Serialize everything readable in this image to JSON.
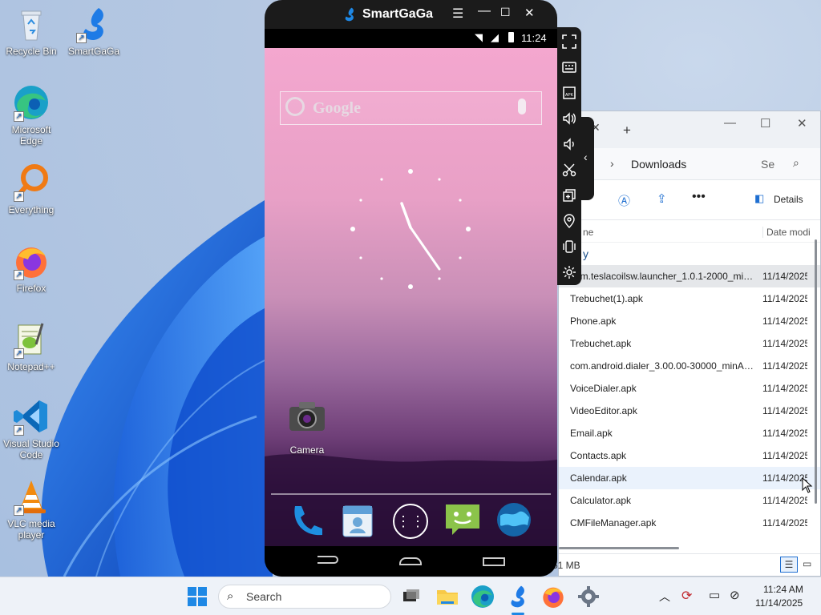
{
  "desktop": {
    "icons": [
      {
        "label": "Recycle Bin",
        "icon": "recycle-bin-icon"
      },
      {
        "label": "SmartGaGa",
        "icon": "smartgaga-icon"
      },
      {
        "label": "Microsoft Edge",
        "icon": "edge-icon"
      },
      {
        "label": "Everything",
        "icon": "everything-search-icon"
      },
      {
        "label": "Firefox",
        "icon": "firefox-icon"
      },
      {
        "label": "Notepad++",
        "icon": "notepadpp-icon"
      },
      {
        "label": "Visual Studio Code",
        "icon": "vscode-icon"
      },
      {
        "label": "VLC media player",
        "icon": "vlc-icon"
      }
    ]
  },
  "emulator": {
    "title": "SmartGaGa",
    "status_time": "11:24",
    "search_placeholder": "Google",
    "camera_label": "Camera",
    "sidebar_tools": [
      "fullscreen-icon",
      "keyboard-icon",
      "install-apk-icon",
      "volume-up-icon",
      "volume-down-icon",
      "screenshot-scissors-icon",
      "multi-instance-icon",
      "location-icon",
      "shake-icon",
      "settings-icon"
    ],
    "dock": [
      "phone-icon",
      "contacts-icon",
      "app-drawer-icon",
      "messaging-icon",
      "browser-icon"
    ],
    "accent": "#1e88e5"
  },
  "explorer": {
    "address": "Downloads",
    "search_placeholder": "Se",
    "details_label": "Details",
    "columns": {
      "name": "ne",
      "date": "Date modi"
    },
    "group_label": "y",
    "rows": [
      {
        "name": "com.teslacoilsw.launcher_1.0.1-2000_min...",
        "date": "11/14/2025"
      },
      {
        "name": "Trebuchet(1).apk",
        "date": "11/14/2025"
      },
      {
        "name": "Phone.apk",
        "date": "11/14/2025"
      },
      {
        "name": "Trebuchet.apk",
        "date": "11/14/2025"
      },
      {
        "name": "com.android.dialer_3.00.00-30000_minAP...",
        "date": "11/14/2025"
      },
      {
        "name": "VoiceDialer.apk",
        "date": "11/14/2025"
      },
      {
        "name": "VideoEditor.apk",
        "date": "11/14/2025"
      },
      {
        "name": "Email.apk",
        "date": "11/14/2025"
      },
      {
        "name": "Contacts.apk",
        "date": "11/14/2025"
      },
      {
        "name": "Calendar.apk",
        "date": "11/14/2025"
      },
      {
        "name": "Calculator.apk",
        "date": "11/14/2025"
      },
      {
        "name": "CMFileManager.apk",
        "date": "11/14/2025"
      }
    ],
    "status": "51 MB"
  },
  "taskbar": {
    "search_label": "Search",
    "time": "11:24 AM",
    "date": "11/14/2025"
  }
}
